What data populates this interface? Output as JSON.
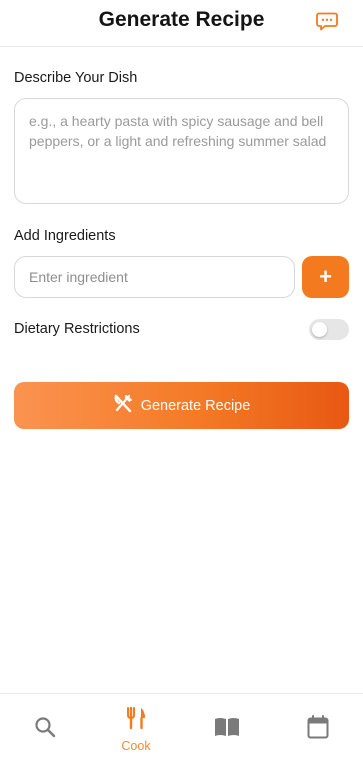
{
  "header": {
    "title": "Generate Recipe",
    "chat_icon": "chat-bubble-icon"
  },
  "dish": {
    "label": "Describe Your Dish",
    "placeholder": "e.g., a hearty pasta with spicy sausage and bell peppers, or a light and refreshing summer salad",
    "value": ""
  },
  "ingredients": {
    "label": "Add Ingredients",
    "placeholder": "Enter ingredient",
    "value": "",
    "add_label": "+"
  },
  "dietary": {
    "label": "Dietary Restrictions",
    "enabled": false
  },
  "generate_button": {
    "label": "Generate Recipe",
    "icon": "utensils-crossed-icon"
  },
  "tabs": [
    {
      "icon": "search-icon",
      "label": "",
      "active": false
    },
    {
      "icon": "fork-knife-icon",
      "label": "Cook",
      "active": true
    },
    {
      "icon": "book-icon",
      "label": "",
      "active": false
    },
    {
      "icon": "calendar-icon",
      "label": "",
      "active": false
    }
  ],
  "colors": {
    "accent": "#f47a1f",
    "accent_light": "#fb9350",
    "inactive_icon": "#7a7a7a",
    "toggle_off": "#e6e6e6"
  }
}
